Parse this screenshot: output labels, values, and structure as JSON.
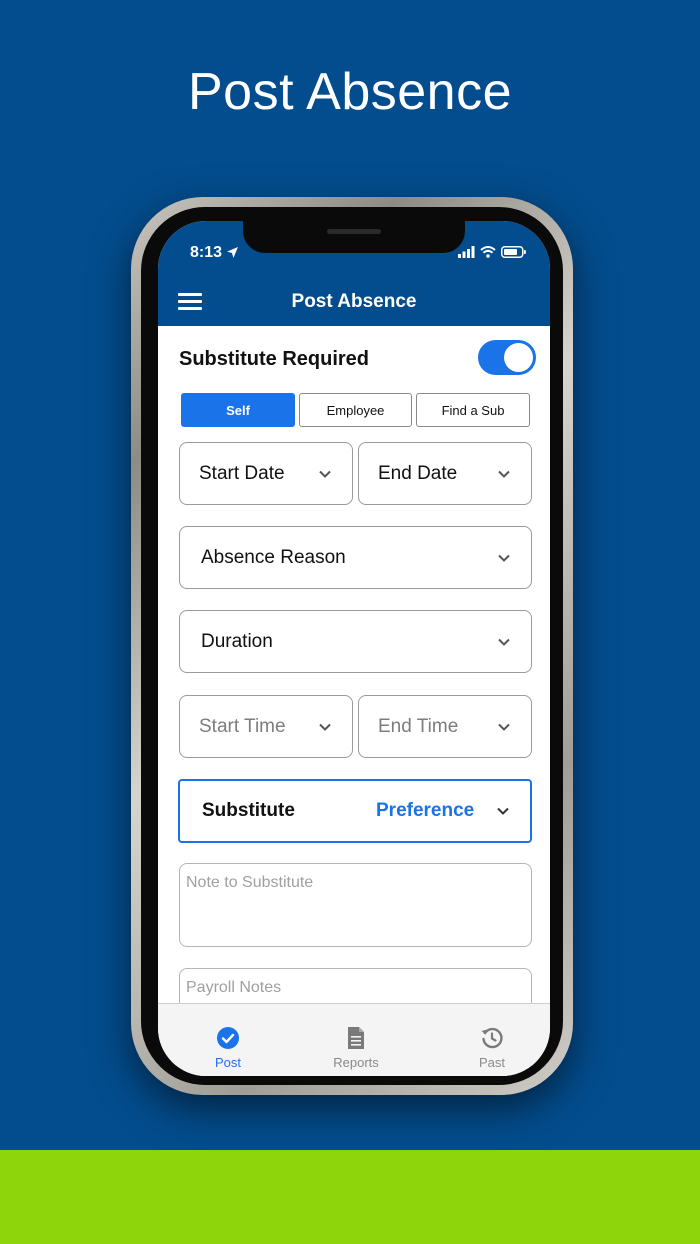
{
  "headline": "Post Absence",
  "colors": {
    "brand": "#034d8e",
    "accent": "#1a73e8",
    "band": "#8fd50c"
  },
  "status_bar": {
    "time": "8:13",
    "icons": [
      "location-arrow-icon",
      "signal-icon",
      "wifi-icon",
      "battery-icon"
    ]
  },
  "app_header": {
    "title": "Post Absence",
    "menu_icon": "hamburger-menu-icon"
  },
  "substitute_required": {
    "label": "Substitute Required",
    "enabled": true
  },
  "segments": [
    {
      "label": "Self",
      "active": true
    },
    {
      "label": "Employee",
      "active": false
    },
    {
      "label": "Find a Sub",
      "active": false
    }
  ],
  "fields": {
    "start_date": "Start Date",
    "end_date": "End Date",
    "absence_reason": "Absence Reason",
    "duration": "Duration",
    "start_time": "Start Time",
    "end_time": "End Time"
  },
  "substitute_preference": {
    "label": "Substitute",
    "value": "Preference"
  },
  "note_to_substitute": {
    "placeholder": "Note to Substitute"
  },
  "payroll_notes": {
    "placeholder": "Payroll Notes"
  },
  "tabbar": {
    "tabs": [
      {
        "label": "Post",
        "icon": "check-circle-icon",
        "active": true
      },
      {
        "label": "Reports",
        "icon": "document-icon",
        "active": false
      },
      {
        "label": "Past",
        "icon": "history-icon",
        "active": false
      }
    ]
  }
}
